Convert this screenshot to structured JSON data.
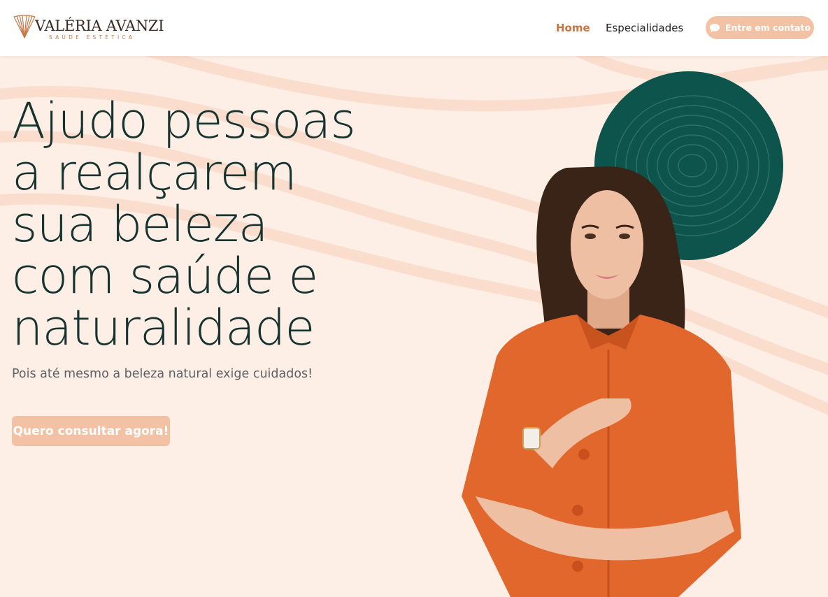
{
  "brand": {
    "name": "VALÉRIA AVANZI",
    "subtitle": "SAÚDE ESTÉTICA",
    "accent_color": "#c7733f",
    "peach_color": "#f3c2a4",
    "dark_green": "#0c544c",
    "background": "#fdeee6"
  },
  "nav": {
    "items": [
      {
        "label": "Home",
        "active": true
      },
      {
        "label": "Especialidades",
        "active": false
      }
    ],
    "cta_label": "Entre em contato",
    "cta_icon": "chat-bubble-icon"
  },
  "hero": {
    "headline_lines": [
      "Ajudo pessoas",
      "a realçarem",
      "sua beleza",
      "com saúde e",
      "naturalidade"
    ],
    "subtitle": "Pois até mesmo a beleza natural exige cuidados!",
    "cta_label": "Quero consultar agora!"
  }
}
